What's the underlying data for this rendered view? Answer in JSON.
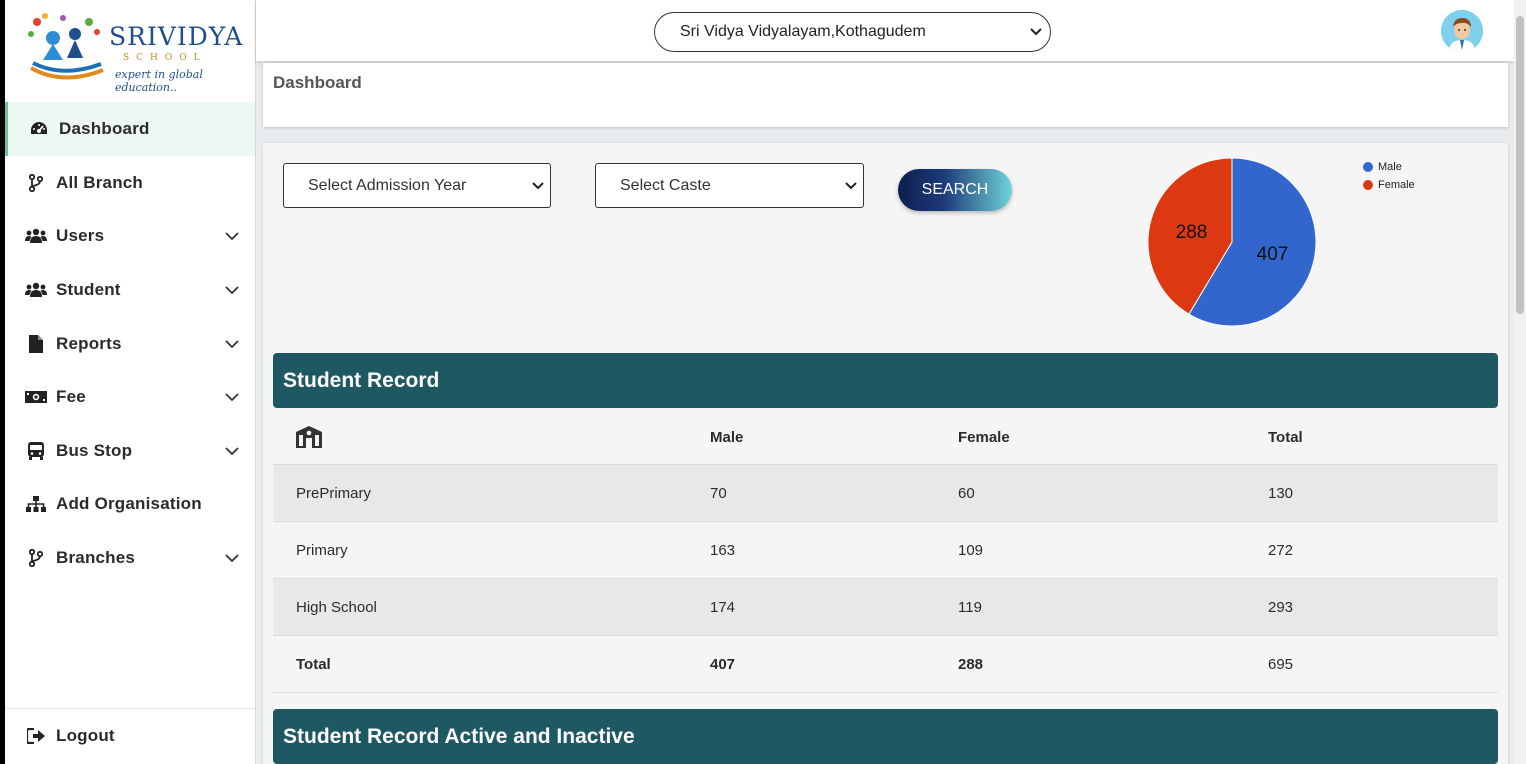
{
  "brand": {
    "name": "SRIVIDYA",
    "sub": "SCHOOL",
    "tagline": "expert in global education.."
  },
  "sidebar": {
    "items": [
      {
        "label": "Dashboard",
        "icon": "dashboard-gauge-icon",
        "active": true,
        "has_submenu": false
      },
      {
        "label": "All Branch",
        "icon": "branch-fork-icon",
        "active": false,
        "has_submenu": false
      },
      {
        "label": "Users",
        "icon": "users-group-icon",
        "active": false,
        "has_submenu": true
      },
      {
        "label": "Student",
        "icon": "users-group-icon",
        "active": false,
        "has_submenu": true
      },
      {
        "label": "Reports",
        "icon": "file-icon",
        "active": false,
        "has_submenu": true
      },
      {
        "label": "Fee",
        "icon": "money-bill-icon",
        "active": false,
        "has_submenu": true
      },
      {
        "label": "Bus Stop",
        "icon": "bus-icon",
        "active": false,
        "has_submenu": true
      },
      {
        "label": "Add Organisation",
        "icon": "sitemap-icon",
        "active": false,
        "has_submenu": false
      },
      {
        "label": "Branches",
        "icon": "branch-fork-icon",
        "active": false,
        "has_submenu": true
      }
    ],
    "logout": {
      "label": "Logout",
      "icon": "sign-out-icon"
    }
  },
  "topbar": {
    "branch_selected": "Sri Vidya Vidyalayam,Kothagudem"
  },
  "breadcrumb": {
    "title": "Dashboard"
  },
  "filters": {
    "admission_year": "Select Admission Year",
    "caste": "Select Caste",
    "search_label": "SEARCH"
  },
  "chart_data": {
    "type": "pie",
    "labels": [
      "Male",
      "Female"
    ],
    "values": [
      407,
      288
    ],
    "colors": [
      "#3366cc",
      "#dc3912"
    ],
    "legend_position": "top-right"
  },
  "student_record": {
    "title": "Student Record",
    "columns": [
      "",
      "Male",
      "Female",
      "Total"
    ],
    "rows": [
      {
        "level": "PrePrimary",
        "male": "70",
        "female": "60",
        "total": "130"
      },
      {
        "level": "Primary",
        "male": "163",
        "female": "109",
        "total": "272"
      },
      {
        "level": "High School",
        "male": "174",
        "female": "119",
        "total": "293"
      }
    ],
    "total": {
      "label": "Total",
      "male": "407",
      "female": "288",
      "total": "695"
    }
  },
  "active_inactive": {
    "title": "Student Record Active and Inactive"
  },
  "colors": {
    "section_header": "#1e5862",
    "active_nav_bg": "#edf8f2",
    "male": "#3366cc",
    "female": "#dc3912"
  }
}
